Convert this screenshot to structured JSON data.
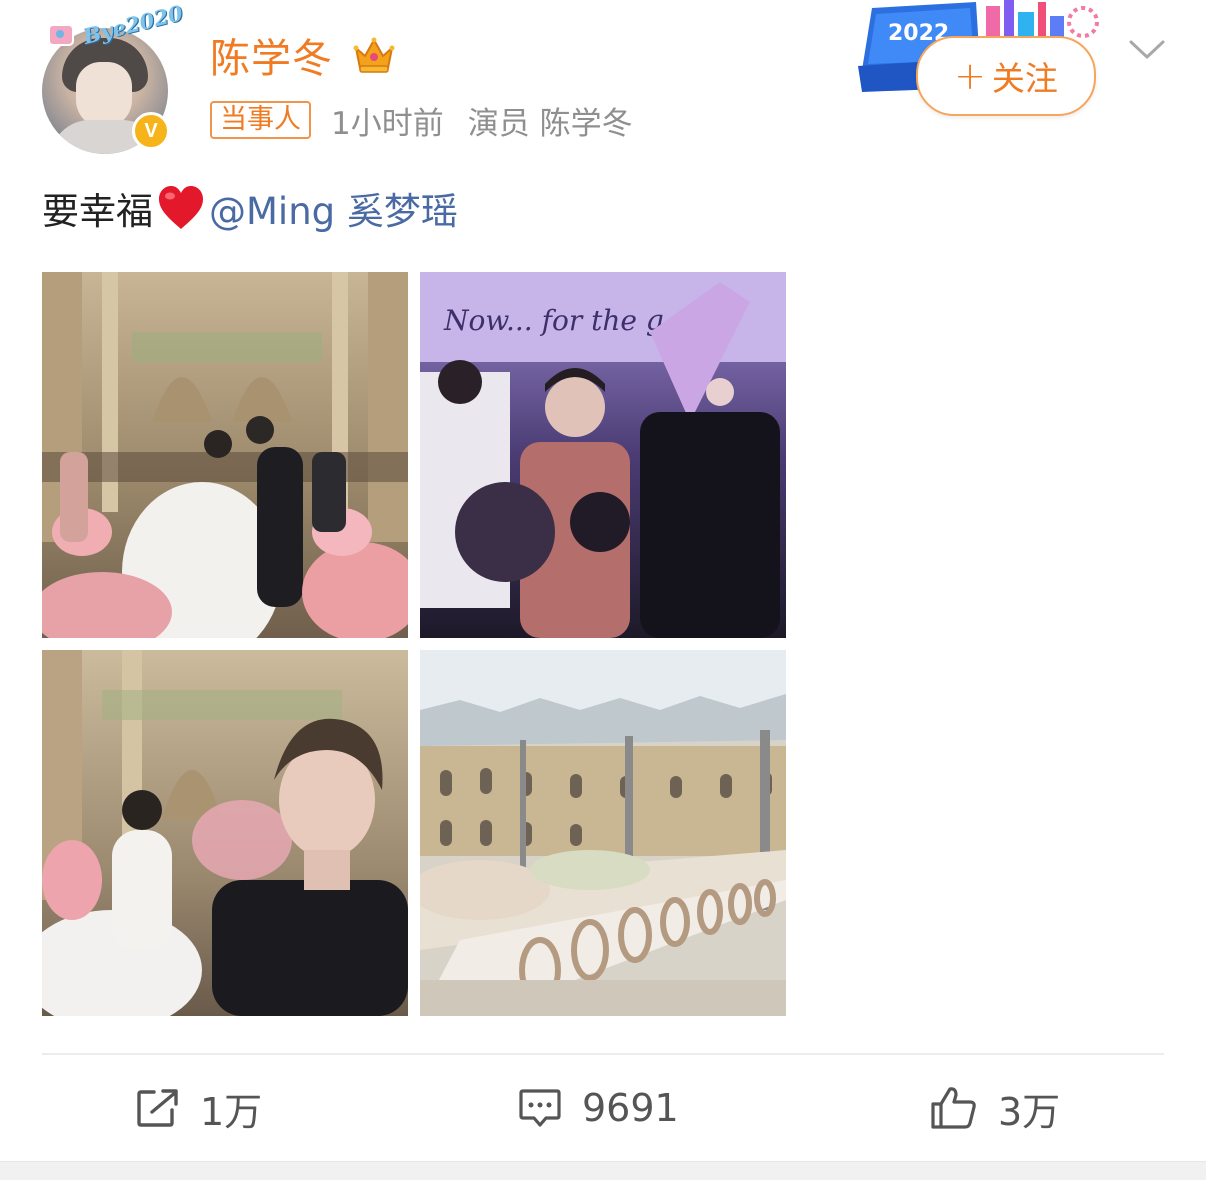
{
  "user": {
    "name": "陈学冬",
    "avatar_frame_text": "Bye2020",
    "badge": "crown-badge",
    "verified_mark": "V"
  },
  "meta": {
    "tag": "当事人",
    "time": "1小时前",
    "role": "演员 陈学冬"
  },
  "header": {
    "event_badge_text": "2022",
    "follow_label": "关注",
    "follow_symbol": "+"
  },
  "post": {
    "text": "要幸福",
    "emoji": "heart-emoji",
    "mention": "@Ming 奚梦瑶"
  },
  "photos": {
    "p2_caption": "Now... for the g   d fin"
  },
  "actions": {
    "repost_count": "1万",
    "comment_count": "9691",
    "like_count": "3万"
  },
  "colors": {
    "accent": "#f07b23",
    "mention": "#4a6aa3",
    "verified": "#f6b41a",
    "meta": "#8f8f8f"
  }
}
